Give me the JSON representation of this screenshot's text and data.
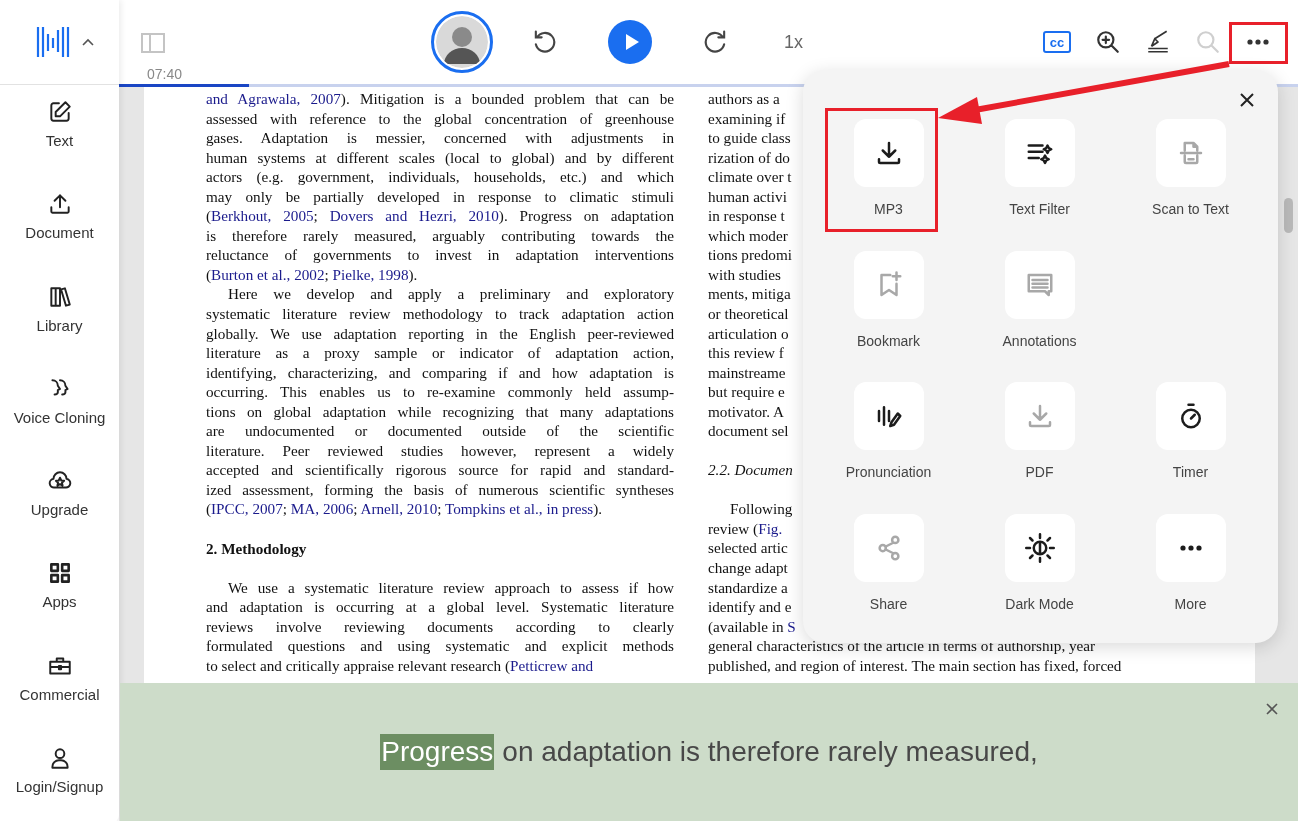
{
  "sidebar": {
    "items": [
      {
        "label": "Text"
      },
      {
        "label": "Document"
      },
      {
        "label": "Library"
      },
      {
        "label": "Voice Cloning"
      },
      {
        "label": "Upgrade"
      },
      {
        "label": "Apps"
      },
      {
        "label": "Commercial"
      },
      {
        "label": "Login/Signup"
      }
    ]
  },
  "toolbar": {
    "time": "07:40",
    "speed": "1x",
    "captions": "cc",
    "progress": {
      "level": 0.11
    },
    "search": {
      "disabled": true
    },
    "more": {
      "highlighted": true
    }
  },
  "document": {
    "left_column": [
      {
        "kind": "paragraph",
        "indent": false,
        "lines": [
          [
            {
              "text": "and Agrawala, 2007",
              "link": true
            },
            {
              "text": "). Mitigation is a bounded problem that can be",
              "link": false
            }
          ],
          "assessed with reference to the global concentration of greenhouse",
          "gases. Adaptation is messier, concerned with adjustments in",
          "human systems at different scales (local to global) and by different",
          "actors (e.g. government, individuals, households, etc.) and which",
          "may only be partially developed in response to climatic stimuli",
          [
            {
              "text": "(",
              "link": false
            },
            {
              "text": "Berkhout, 2005",
              "link": true
            },
            {
              "text": "; ",
              "link": false
            },
            {
              "text": "Dovers and Hezri, 2010",
              "link": true
            },
            {
              "text": "). Progress on adaptation",
              "link": false
            }
          ],
          "is therefore rarely measured, arguably contributing towards the",
          "reluctance of governments to invest in adaptation interventions",
          [
            {
              "text": "(",
              "link": false
            },
            {
              "text": "Burton et  al., 2002",
              "link": true
            },
            {
              "text": "; ",
              "link": false
            },
            {
              "text": "Pielke, 1998",
              "link": true
            },
            {
              "text": ").",
              "link": false
            }
          ]
        ]
      },
      {
        "kind": "paragraph",
        "indent": true,
        "lines": [
          "Here we develop and apply a preliminary and exploratory",
          "systematic literature review methodology to track adaptation action",
          "globally. We use adaptation reporting in the English peer-reviewed",
          "literature as a proxy sample or indicator of adaptation action,",
          "identifying, characterizing, and comparing if and how adaptation is",
          "occurring. This enables us to re-examine commonly held assump-",
          "tions on global adaptation while recognizing that many adaptations",
          "are undocumented or documented outside of the scientific",
          "literature. Peer reviewed studies however, represent a widely",
          "accepted and scientifically rigorous source for rapid and standard-",
          "ized assessment, forming the basis of numerous scientific syntheses",
          [
            {
              "text": "(",
              "link": false
            },
            {
              "text": "IPCC, 2007",
              "link": true
            },
            {
              "text": "; ",
              "link": false
            },
            {
              "text": "MA, 2006",
              "link": true
            },
            {
              "text": "; ",
              "link": false
            },
            {
              "text": "Arnell, 2010",
              "link": true
            },
            {
              "text": "; ",
              "link": false
            },
            {
              "text": "Tompkins et  al., in press",
              "link": true
            },
            {
              "text": ").",
              "link": false
            }
          ]
        ]
      },
      {
        "kind": "section_heading",
        "text": "2.  Methodology"
      },
      {
        "kind": "paragraph",
        "indent": true,
        "lines": [
          "We use a systematic literature review approach to assess if how",
          "and adaptation is occurring at a global level. Systematic literature",
          "reviews involve reviewing documents according to clearly",
          "formulated questions and using systematic and explicit methods",
          [
            {
              "text": "to select and critically appraise relevant research (",
              "link": false
            },
            {
              "text": "Petticrew and",
              "link": true
            }
          ]
        ]
      }
    ],
    "right_column": [
      {
        "kind": "paragraph",
        "indent": false,
        "lines": [
          "authors as a",
          "examining if",
          "to guide class",
          "rization of do",
          "climate over t",
          "human activi",
          "in response t",
          "which moder",
          "tions predomi",
          "with studies",
          "ments, mitiga",
          "or theoretical",
          "articulation o",
          "this review f",
          "mainstreame",
          "but require e",
          "motivator. A",
          "document sel"
        ]
      },
      {
        "kind": "subsection_heading",
        "text": "2.2. Documen"
      },
      {
        "kind": "paragraph",
        "indent": true,
        "lines": [
          "Following",
          [
            {
              "text": "review (",
              "link": false
            },
            {
              "text": "Fig.",
              "link": true
            }
          ],
          "selected artic",
          "change adapt",
          "standardize a",
          "identify and e",
          [
            {
              "text": "(available in ",
              "link": false
            },
            {
              "text": "S",
              "link": true
            }
          ],
          "general characteristics of the article in terms of authorship, year",
          "published, and region of interest. The main section has fixed, forced"
        ]
      }
    ]
  },
  "menu": {
    "rows": [
      [
        {
          "label": "MP3",
          "disabled": false,
          "highlighted": true
        },
        {
          "label": "Text Filter",
          "disabled": false,
          "highlighted": false
        },
        {
          "label": "Scan to Text",
          "disabled": true,
          "highlighted": false
        }
      ],
      [
        {
          "label": "Bookmark",
          "disabled": true,
          "highlighted": false
        },
        {
          "label": "Annotations",
          "disabled": true,
          "highlighted": false
        }
      ],
      [
        {
          "label": "Pronunciation",
          "disabled": false,
          "highlighted": false
        },
        {
          "label": "PDF",
          "disabled": true,
          "highlighted": false
        },
        {
          "label": "Timer",
          "disabled": false,
          "highlighted": false
        }
      ],
      [
        {
          "label": "Share",
          "disabled": true,
          "highlighted": false
        },
        {
          "label": "Dark Mode",
          "disabled": false,
          "highlighted": false
        },
        {
          "label": "More",
          "disabled": false,
          "highlighted": false
        }
      ]
    ]
  },
  "reading_banner": {
    "current_word": "Progress",
    "text": "on adaptation is therefore rarely measured,"
  }
}
